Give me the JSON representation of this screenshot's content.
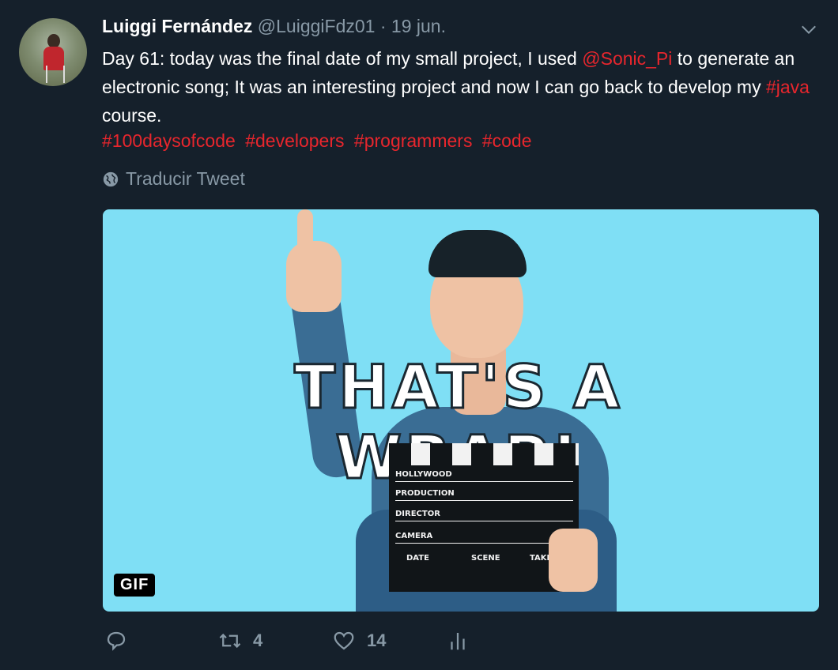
{
  "tweet": {
    "author_name": "Luiggi Fernández",
    "author_handle": "@LuiggiFdz01",
    "separator": "·",
    "date": "19 jun.",
    "text_part1": "Day 61: today was the final date of my small project, I used ",
    "mention": "@Sonic_Pi",
    "text_part2": " to generate an electronic song; It was an interesting project and now I can go back to develop my ",
    "hashtag_inline": "#java",
    "text_part3": " course.",
    "hashtags": [
      "#100daysofcode",
      "#developers",
      "#programmers",
      "#code"
    ],
    "translate_label": "Traducir Tweet",
    "media": {
      "overlay_text": "THAT'S A WRAP!",
      "clapper_labels": [
        "HOLLYWOOD",
        "PRODUCTION",
        "DIRECTOR",
        "CAMERA",
        "DATE",
        "SCENE",
        "TAKE"
      ],
      "badge": "GIF"
    },
    "actions": {
      "reply_count": "",
      "retweet_count": "4",
      "like_count": "14"
    },
    "colors": {
      "background": "#15202b",
      "link": "#e8262d",
      "muted": "#8899a6",
      "media_bg": "#7fdff5"
    },
    "icons": [
      "chevron-down-icon",
      "globe-icon",
      "reply-icon",
      "retweet-icon",
      "heart-icon",
      "analytics-icon"
    ]
  }
}
